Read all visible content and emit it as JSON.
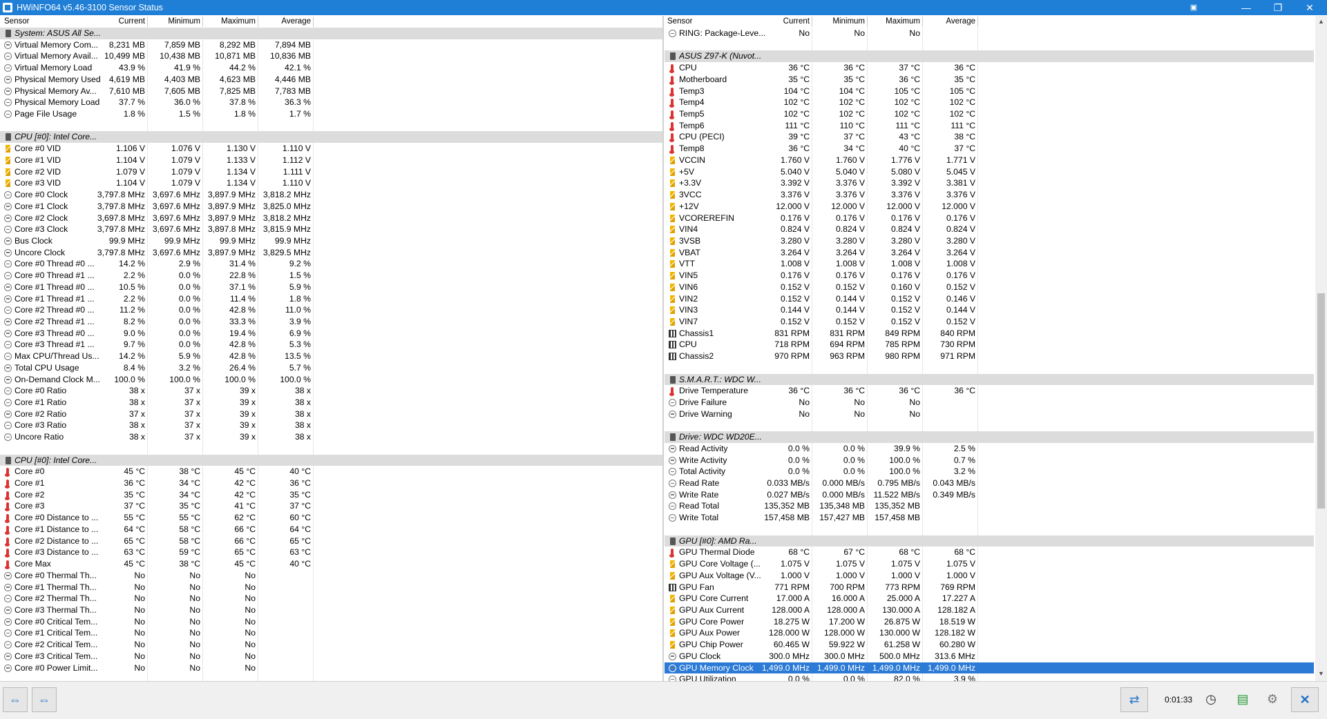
{
  "window": {
    "title": "HWiNFO64 v5.46-3100 Sensor Status",
    "minimize": "—",
    "maximize": "❐",
    "close": "✕"
  },
  "columns": [
    "Sensor",
    "Current",
    "Minimum",
    "Maximum",
    "Average"
  ],
  "left_rows": [
    {
      "type": "group",
      "name": "System: ASUS All Se..."
    },
    {
      "icon": "gauge",
      "name": "Virtual Memory Com...",
      "cur": "8,231 MB",
      "min": "7,859 MB",
      "max": "8,292 MB",
      "avg": "7,894 MB"
    },
    {
      "icon": "gauge",
      "name": "Virtual Memory Avail...",
      "cur": "10,499 MB",
      "min": "10,438 MB",
      "max": "10,871 MB",
      "avg": "10,836 MB"
    },
    {
      "icon": "gauge",
      "name": "Virtual Memory Load",
      "cur": "43.9 %",
      "min": "41.9 %",
      "max": "44.2 %",
      "avg": "42.1 %"
    },
    {
      "icon": "gauge",
      "name": "Physical Memory Used",
      "cur": "4,619 MB",
      "min": "4,403 MB",
      "max": "4,623 MB",
      "avg": "4,446 MB"
    },
    {
      "icon": "gauge",
      "name": "Physical Memory Av...",
      "cur": "7,610 MB",
      "min": "7,605 MB",
      "max": "7,825 MB",
      "avg": "7,783 MB"
    },
    {
      "icon": "gauge",
      "name": "Physical Memory Load",
      "cur": "37.7 %",
      "min": "36.0 %",
      "max": "37.8 %",
      "avg": "36.3 %"
    },
    {
      "icon": "gauge",
      "name": "Page File Usage",
      "cur": "1.8 %",
      "min": "1.5 %",
      "max": "1.8 %",
      "avg": "1.7 %"
    },
    {
      "type": "blank"
    },
    {
      "type": "group",
      "name": "CPU [#0]: Intel Core..."
    },
    {
      "icon": "volt",
      "name": "Core #0 VID",
      "cur": "1.106 V",
      "min": "1.076 V",
      "max": "1.130 V",
      "avg": "1.110 V"
    },
    {
      "icon": "volt",
      "name": "Core #1 VID",
      "cur": "1.104 V",
      "min": "1.079 V",
      "max": "1.133 V",
      "avg": "1.112 V"
    },
    {
      "icon": "volt",
      "name": "Core #2 VID",
      "cur": "1.079 V",
      "min": "1.079 V",
      "max": "1.134 V",
      "avg": "1.111 V"
    },
    {
      "icon": "volt",
      "name": "Core #3 VID",
      "cur": "1.104 V",
      "min": "1.079 V",
      "max": "1.134 V",
      "avg": "1.110 V"
    },
    {
      "icon": "gauge",
      "name": "Core #0 Clock",
      "cur": "3,797.8 MHz",
      "min": "3,697.6 MHz",
      "max": "3,897.9 MHz",
      "avg": "3,818.2 MHz"
    },
    {
      "icon": "gauge",
      "name": "Core #1 Clock",
      "cur": "3,797.8 MHz",
      "min": "3,697.6 MHz",
      "max": "3,897.9 MHz",
      "avg": "3,825.0 MHz"
    },
    {
      "icon": "gauge",
      "name": "Core #2 Clock",
      "cur": "3,697.8 MHz",
      "min": "3,697.6 MHz",
      "max": "3,897.9 MHz",
      "avg": "3,818.2 MHz"
    },
    {
      "icon": "gauge",
      "name": "Core #3 Clock",
      "cur": "3,797.8 MHz",
      "min": "3,697.6 MHz",
      "max": "3,897.8 MHz",
      "avg": "3,815.9 MHz"
    },
    {
      "icon": "gauge",
      "name": "Bus Clock",
      "cur": "99.9 MHz",
      "min": "99.9 MHz",
      "max": "99.9 MHz",
      "avg": "99.9 MHz"
    },
    {
      "icon": "gauge",
      "name": "Uncore Clock",
      "cur": "3,797.8 MHz",
      "min": "3,697.6 MHz",
      "max": "3,897.9 MHz",
      "avg": "3,829.5 MHz"
    },
    {
      "icon": "gauge",
      "name": "Core #0 Thread #0 ...",
      "cur": "14.2 %",
      "min": "2.9 %",
      "max": "31.4 %",
      "avg": "9.2 %"
    },
    {
      "icon": "gauge",
      "name": "Core #0 Thread #1 ...",
      "cur": "2.2 %",
      "min": "0.0 %",
      "max": "22.8 %",
      "avg": "1.5 %"
    },
    {
      "icon": "gauge",
      "name": "Core #1 Thread #0 ...",
      "cur": "10.5 %",
      "min": "0.0 %",
      "max": "37.1 %",
      "avg": "5.9 %"
    },
    {
      "icon": "gauge",
      "name": "Core #1 Thread #1 ...",
      "cur": "2.2 %",
      "min": "0.0 %",
      "max": "11.4 %",
      "avg": "1.8 %"
    },
    {
      "icon": "gauge",
      "name": "Core #2 Thread #0 ...",
      "cur": "11.2 %",
      "min": "0.0 %",
      "max": "42.8 %",
      "avg": "11.0 %"
    },
    {
      "icon": "gauge",
      "name": "Core #2 Thread #1 ...",
      "cur": "8.2 %",
      "min": "0.0 %",
      "max": "33.3 %",
      "avg": "3.9 %"
    },
    {
      "icon": "gauge",
      "name": "Core #3 Thread #0 ...",
      "cur": "9.0 %",
      "min": "0.0 %",
      "max": "19.4 %",
      "avg": "6.9 %"
    },
    {
      "icon": "gauge",
      "name": "Core #3 Thread #1 ...",
      "cur": "9.7 %",
      "min": "0.0 %",
      "max": "42.8 %",
      "avg": "5.3 %"
    },
    {
      "icon": "gauge",
      "name": "Max CPU/Thread Us...",
      "cur": "14.2 %",
      "min": "5.9 %",
      "max": "42.8 %",
      "avg": "13.5 %"
    },
    {
      "icon": "gauge",
      "name": "Total CPU Usage",
      "cur": "8.4 %",
      "min": "3.2 %",
      "max": "26.4 %",
      "avg": "5.7 %"
    },
    {
      "icon": "gauge",
      "name": "On-Demand Clock M...",
      "cur": "100.0 %",
      "min": "100.0 %",
      "max": "100.0 %",
      "avg": "100.0 %"
    },
    {
      "icon": "gauge",
      "name": "Core #0 Ratio",
      "cur": "38 x",
      "min": "37 x",
      "max": "39 x",
      "avg": "38 x"
    },
    {
      "icon": "gauge",
      "name": "Core #1 Ratio",
      "cur": "38 x",
      "min": "37 x",
      "max": "39 x",
      "avg": "38 x"
    },
    {
      "icon": "gauge",
      "name": "Core #2 Ratio",
      "cur": "37 x",
      "min": "37 x",
      "max": "39 x",
      "avg": "38 x"
    },
    {
      "icon": "gauge",
      "name": "Core #3 Ratio",
      "cur": "38 x",
      "min": "37 x",
      "max": "39 x",
      "avg": "38 x"
    },
    {
      "icon": "gauge",
      "name": "Uncore Ratio",
      "cur": "38 x",
      "min": "37 x",
      "max": "39 x",
      "avg": "38 x"
    },
    {
      "type": "blank"
    },
    {
      "type": "group",
      "name": "CPU [#0]: Intel Core..."
    },
    {
      "icon": "temp",
      "name": "Core #0",
      "cur": "45 °C",
      "min": "38 °C",
      "max": "45 °C",
      "avg": "40 °C"
    },
    {
      "icon": "temp",
      "name": "Core #1",
      "cur": "36 °C",
      "min": "34 °C",
      "max": "42 °C",
      "avg": "36 °C"
    },
    {
      "icon": "temp",
      "name": "Core #2",
      "cur": "35 °C",
      "min": "34 °C",
      "max": "42 °C",
      "avg": "35 °C"
    },
    {
      "icon": "temp",
      "name": "Core #3",
      "cur": "37 °C",
      "min": "35 °C",
      "max": "41 °C",
      "avg": "37 °C"
    },
    {
      "icon": "temp",
      "name": "Core #0 Distance to ...",
      "cur": "55 °C",
      "min": "55 °C",
      "max": "62 °C",
      "avg": "60 °C"
    },
    {
      "icon": "temp",
      "name": "Core #1 Distance to ...",
      "cur": "64 °C",
      "min": "58 °C",
      "max": "66 °C",
      "avg": "64 °C"
    },
    {
      "icon": "temp",
      "name": "Core #2 Distance to ...",
      "cur": "65 °C",
      "min": "58 °C",
      "max": "66 °C",
      "avg": "65 °C"
    },
    {
      "icon": "temp",
      "name": "Core #3 Distance to ...",
      "cur": "63 °C",
      "min": "59 °C",
      "max": "65 °C",
      "avg": "63 °C"
    },
    {
      "icon": "temp",
      "name": "Core Max",
      "cur": "45 °C",
      "min": "38 °C",
      "max": "45 °C",
      "avg": "40 °C"
    },
    {
      "icon": "gauge",
      "name": "Core #0 Thermal Th...",
      "cur": "No",
      "min": "No",
      "max": "No",
      "avg": ""
    },
    {
      "icon": "gauge",
      "name": "Core #1 Thermal Th...",
      "cur": "No",
      "min": "No",
      "max": "No",
      "avg": ""
    },
    {
      "icon": "gauge",
      "name": "Core #2 Thermal Th...",
      "cur": "No",
      "min": "No",
      "max": "No",
      "avg": ""
    },
    {
      "icon": "gauge",
      "name": "Core #3 Thermal Th...",
      "cur": "No",
      "min": "No",
      "max": "No",
      "avg": ""
    },
    {
      "icon": "gauge",
      "name": "Core #0 Critical Tem...",
      "cur": "No",
      "min": "No",
      "max": "No",
      "avg": ""
    },
    {
      "icon": "gauge",
      "name": "Core #1 Critical Tem...",
      "cur": "No",
      "min": "No",
      "max": "No",
      "avg": ""
    },
    {
      "icon": "gauge",
      "name": "Core #2 Critical Tem...",
      "cur": "No",
      "min": "No",
      "max": "No",
      "avg": ""
    },
    {
      "icon": "gauge",
      "name": "Core #3 Critical Tem...",
      "cur": "No",
      "min": "No",
      "max": "No",
      "avg": ""
    },
    {
      "icon": "gauge",
      "name": "Core #0 Power Limit...",
      "cur": "No",
      "min": "No",
      "max": "No",
      "avg": ""
    }
  ],
  "right_rows": [
    {
      "icon": "gauge",
      "name": "RING: Package-Leve...",
      "cur": "No",
      "min": "No",
      "max": "No",
      "avg": ""
    },
    {
      "type": "blank"
    },
    {
      "type": "group",
      "name": "ASUS Z97-K (Nuvot..."
    },
    {
      "icon": "temp",
      "name": "CPU",
      "cur": "36 °C",
      "min": "36 °C",
      "max": "37 °C",
      "avg": "36 °C"
    },
    {
      "icon": "temp",
      "name": "Motherboard",
      "cur": "35 °C",
      "min": "35 °C",
      "max": "36 °C",
      "avg": "35 °C"
    },
    {
      "icon": "temp",
      "name": "Temp3",
      "cur": "104 °C",
      "min": "104 °C",
      "max": "105 °C",
      "avg": "105 °C"
    },
    {
      "icon": "temp",
      "name": "Temp4",
      "cur": "102 °C",
      "min": "102 °C",
      "max": "102 °C",
      "avg": "102 °C"
    },
    {
      "icon": "temp",
      "name": "Temp5",
      "cur": "102 °C",
      "min": "102 °C",
      "max": "102 °C",
      "avg": "102 °C"
    },
    {
      "icon": "temp",
      "name": "Temp6",
      "cur": "111 °C",
      "min": "110 °C",
      "max": "111 °C",
      "avg": "111 °C"
    },
    {
      "icon": "temp",
      "name": "CPU (PECI)",
      "cur": "39 °C",
      "min": "37 °C",
      "max": "43 °C",
      "avg": "38 °C"
    },
    {
      "icon": "temp",
      "name": "Temp8",
      "cur": "36 °C",
      "min": "34 °C",
      "max": "40 °C",
      "avg": "37 °C"
    },
    {
      "icon": "volt",
      "name": "VCCIN",
      "cur": "1.760 V",
      "min": "1.760 V",
      "max": "1.776 V",
      "avg": "1.771 V"
    },
    {
      "icon": "volt",
      "name": "+5V",
      "cur": "5.040 V",
      "min": "5.040 V",
      "max": "5.080 V",
      "avg": "5.045 V"
    },
    {
      "icon": "volt",
      "name": "+3.3V",
      "cur": "3.392 V",
      "min": "3.376 V",
      "max": "3.392 V",
      "avg": "3.381 V"
    },
    {
      "icon": "volt",
      "name": "3VCC",
      "cur": "3.376 V",
      "min": "3.376 V",
      "max": "3.376 V",
      "avg": "3.376 V"
    },
    {
      "icon": "volt",
      "name": "+12V",
      "cur": "12.000 V",
      "min": "12.000 V",
      "max": "12.000 V",
      "avg": "12.000 V"
    },
    {
      "icon": "volt",
      "name": "VCOREREFIN",
      "cur": "0.176 V",
      "min": "0.176 V",
      "max": "0.176 V",
      "avg": "0.176 V"
    },
    {
      "icon": "volt",
      "name": "VIN4",
      "cur": "0.824 V",
      "min": "0.824 V",
      "max": "0.824 V",
      "avg": "0.824 V"
    },
    {
      "icon": "volt",
      "name": "3VSB",
      "cur": "3.280 V",
      "min": "3.280 V",
      "max": "3.280 V",
      "avg": "3.280 V"
    },
    {
      "icon": "volt",
      "name": "VBAT",
      "cur": "3.264 V",
      "min": "3.264 V",
      "max": "3.264 V",
      "avg": "3.264 V"
    },
    {
      "icon": "volt",
      "name": "VTT",
      "cur": "1.008 V",
      "min": "1.008 V",
      "max": "1.008 V",
      "avg": "1.008 V"
    },
    {
      "icon": "volt",
      "name": "VIN5",
      "cur": "0.176 V",
      "min": "0.176 V",
      "max": "0.176 V",
      "avg": "0.176 V"
    },
    {
      "icon": "volt",
      "name": "VIN6",
      "cur": "0.152 V",
      "min": "0.152 V",
      "max": "0.160 V",
      "avg": "0.152 V"
    },
    {
      "icon": "volt",
      "name": "VIN2",
      "cur": "0.152 V",
      "min": "0.144 V",
      "max": "0.152 V",
      "avg": "0.146 V"
    },
    {
      "icon": "volt",
      "name": "VIN3",
      "cur": "0.144 V",
      "min": "0.144 V",
      "max": "0.152 V",
      "avg": "0.144 V"
    },
    {
      "icon": "volt",
      "name": "VIN7",
      "cur": "0.152 V",
      "min": "0.152 V",
      "max": "0.152 V",
      "avg": "0.152 V"
    },
    {
      "icon": "fan",
      "name": "Chassis1",
      "cur": "831 RPM",
      "min": "831 RPM",
      "max": "849 RPM",
      "avg": "840 RPM"
    },
    {
      "icon": "fan",
      "name": "CPU",
      "cur": "718 RPM",
      "min": "694 RPM",
      "max": "785 RPM",
      "avg": "730 RPM"
    },
    {
      "icon": "fan",
      "name": "Chassis2",
      "cur": "970 RPM",
      "min": "963 RPM",
      "max": "980 RPM",
      "avg": "971 RPM"
    },
    {
      "type": "blank"
    },
    {
      "type": "group",
      "name": "S.M.A.R.T.: WDC W..."
    },
    {
      "icon": "temp",
      "name": "Drive Temperature",
      "cur": "36 °C",
      "min": "36 °C",
      "max": "36 °C",
      "avg": "36 °C"
    },
    {
      "icon": "gauge",
      "name": "Drive Failure",
      "cur": "No",
      "min": "No",
      "max": "No",
      "avg": ""
    },
    {
      "icon": "gauge",
      "name": "Drive Warning",
      "cur": "No",
      "min": "No",
      "max": "No",
      "avg": ""
    },
    {
      "type": "blank"
    },
    {
      "type": "group",
      "name": "Drive: WDC WD20E..."
    },
    {
      "icon": "gauge",
      "name": "Read Activity",
      "cur": "0.0 %",
      "min": "0.0 %",
      "max": "39.9 %",
      "avg": "2.5 %"
    },
    {
      "icon": "gauge",
      "name": "Write Activity",
      "cur": "0.0 %",
      "min": "0.0 %",
      "max": "100.0 %",
      "avg": "0.7 %"
    },
    {
      "icon": "gauge",
      "name": "Total Activity",
      "cur": "0.0 %",
      "min": "0.0 %",
      "max": "100.0 %",
      "avg": "3.2 %"
    },
    {
      "icon": "gauge",
      "name": "Read Rate",
      "cur": "0.033 MB/s",
      "min": "0.000 MB/s",
      "max": "0.795 MB/s",
      "avg": "0.043 MB/s"
    },
    {
      "icon": "gauge",
      "name": "Write Rate",
      "cur": "0.027 MB/s",
      "min": "0.000 MB/s",
      "max": "11.522 MB/s",
      "avg": "0.349 MB/s"
    },
    {
      "icon": "gauge",
      "name": "Read Total",
      "cur": "135,352 MB",
      "min": "135,348 MB",
      "max": "135,352 MB",
      "avg": ""
    },
    {
      "icon": "gauge",
      "name": "Write Total",
      "cur": "157,458 MB",
      "min": "157,427 MB",
      "max": "157,458 MB",
      "avg": ""
    },
    {
      "type": "blank"
    },
    {
      "type": "group",
      "name": "GPU [#0]: AMD Ra..."
    },
    {
      "icon": "temp",
      "name": "GPU Thermal Diode",
      "cur": "68 °C",
      "min": "67 °C",
      "max": "68 °C",
      "avg": "68 °C"
    },
    {
      "icon": "volt",
      "name": "GPU Core Voltage (...",
      "cur": "1.075 V",
      "min": "1.075 V",
      "max": "1.075 V",
      "avg": "1.075 V"
    },
    {
      "icon": "volt",
      "name": "GPU Aux Voltage (V...",
      "cur": "1.000 V",
      "min": "1.000 V",
      "max": "1.000 V",
      "avg": "1.000 V"
    },
    {
      "icon": "fan",
      "name": "GPU Fan",
      "cur": "771 RPM",
      "min": "700 RPM",
      "max": "773 RPM",
      "avg": "769 RPM"
    },
    {
      "icon": "volt",
      "name": "GPU Core Current",
      "cur": "17.000 A",
      "min": "16.000 A",
      "max": "25.000 A",
      "avg": "17.227 A"
    },
    {
      "icon": "volt",
      "name": "GPU Aux Current",
      "cur": "128.000 A",
      "min": "128.000 A",
      "max": "130.000 A",
      "avg": "128.182 A"
    },
    {
      "icon": "volt",
      "name": "GPU Core Power",
      "cur": "18.275 W",
      "min": "17.200 W",
      "max": "26.875 W",
      "avg": "18.519 W"
    },
    {
      "icon": "volt",
      "name": "GPU Aux Power",
      "cur": "128.000 W",
      "min": "128.000 W",
      "max": "130.000 W",
      "avg": "128.182 W"
    },
    {
      "icon": "volt",
      "name": "GPU Chip Power",
      "cur": "60.465 W",
      "min": "59.922 W",
      "max": "61.258 W",
      "avg": "60.280 W"
    },
    {
      "icon": "gauge",
      "name": "GPU Clock",
      "cur": "300.0 MHz",
      "min": "300.0 MHz",
      "max": "500.0 MHz",
      "avg": "313.6 MHz"
    },
    {
      "icon": "gauge",
      "name": "GPU Memory Clock",
      "cur": "1,499.0 MHz",
      "min": "1,499.0 MHz",
      "max": "1,499.0 MHz",
      "avg": "1,499.0 MHz",
      "selected": true
    },
    {
      "icon": "gauge",
      "name": "GPU Utilization",
      "cur": "0.0 %",
      "min": "0.0 %",
      "max": "82.0 %",
      "avg": "3.9 %"
    }
  ],
  "statusbar": {
    "elapsed": "0:01:33",
    "nav_left": "⇔",
    "nav_right": "⇔"
  }
}
